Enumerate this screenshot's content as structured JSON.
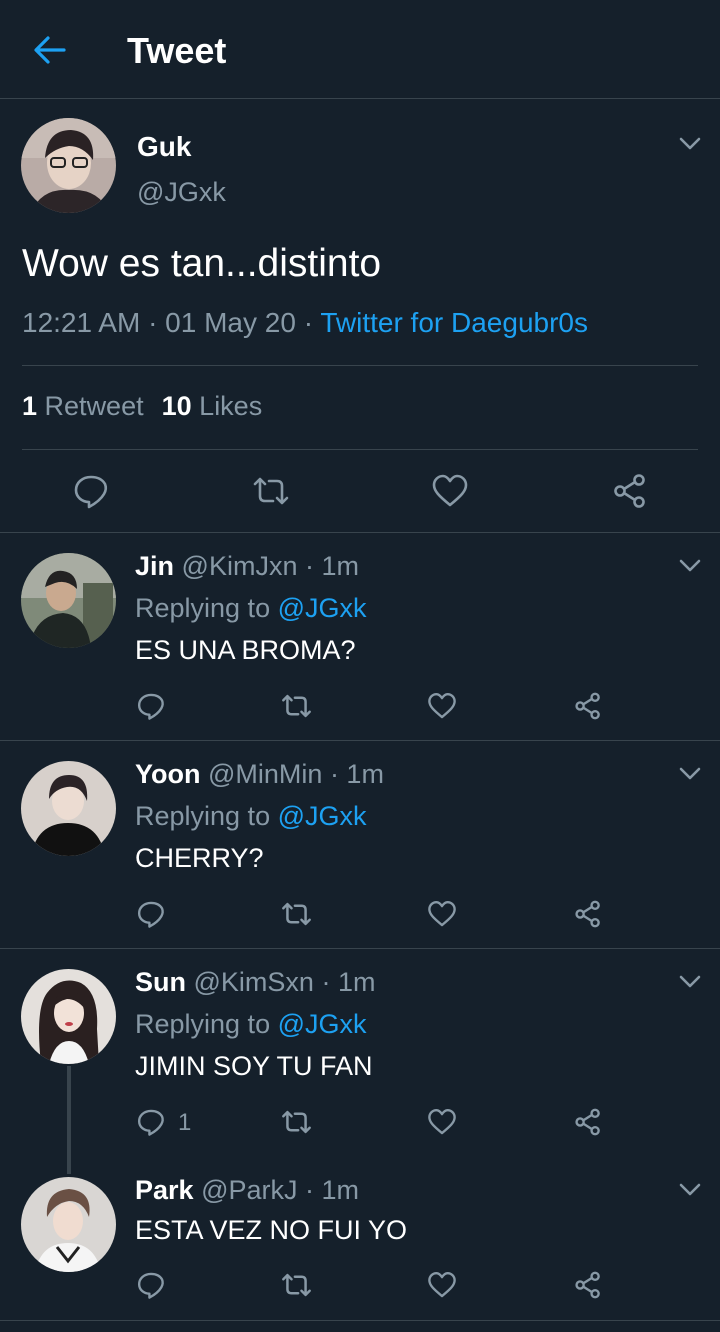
{
  "header": {
    "title": "Tweet",
    "back_icon": "arrow-left-icon"
  },
  "colors": {
    "background": "#15202b",
    "accent": "#1da1f2",
    "muted": "#8899a6",
    "divider": "#38444d"
  },
  "main_tweet": {
    "name": "Guk",
    "handle": "@JGxk",
    "text": "Wow es tan...distinto",
    "time": "12:21 AM · 01 May 20 · ",
    "source": "Twitter for Daegubr0s",
    "retweets_count": "1",
    "retweets_label": "Retweet",
    "likes_count": "10",
    "likes_label": "Likes"
  },
  "replies": [
    {
      "name": "Jin",
      "handle": "@KimJxn",
      "time": "· 1m",
      "replying_label": "Replying to ",
      "replying_to": "@JGxk",
      "text": "ES UNA BROMA?",
      "reply_count": ""
    },
    {
      "name": "Yoon",
      "handle": "@MinMin",
      "time": "· 1m",
      "replying_label": "Replying to ",
      "replying_to": "@JGxk",
      "text": "CHERRY?",
      "reply_count": ""
    },
    {
      "name": "Sun",
      "handle": "@KimSxn",
      "time": "· 1m",
      "replying_label": "Replying to ",
      "replying_to": "@JGxk",
      "text": "JIMIN SOY TU FAN",
      "reply_count": "1"
    },
    {
      "name": "Park",
      "handle": "@ParkJ",
      "time": "· 1m",
      "text": "ESTA VEZ NO FUI YO",
      "reply_count": ""
    }
  ]
}
